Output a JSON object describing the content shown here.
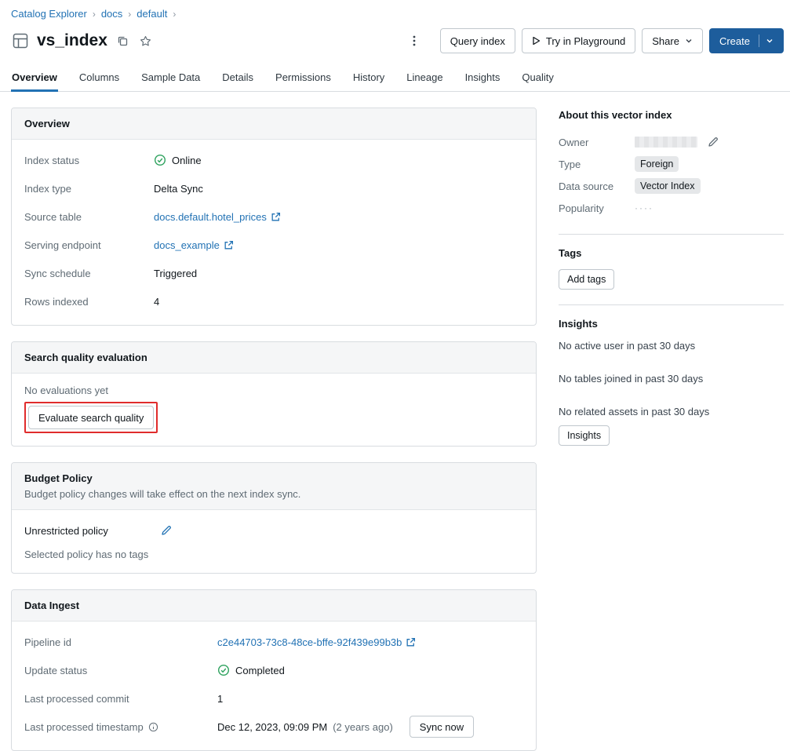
{
  "colors": {
    "accent_link": "#2272B4",
    "primary_button": "#1D5D9C",
    "success_green": "#2EA25E",
    "annotation_red": "#E02C2C",
    "card_header_bg": "#F5F6F7"
  },
  "breadcrumb": {
    "separator": "›",
    "items": [
      "Catalog Explorer",
      "docs",
      "default"
    ]
  },
  "header": {
    "title": "vs_index",
    "query_index_button": "Query index",
    "playground_button": "Try in Playground",
    "share_button": "Share",
    "create_button": "Create"
  },
  "tabs": {
    "active": "Overview",
    "items": [
      "Overview",
      "Columns",
      "Sample Data",
      "Details",
      "Permissions",
      "History",
      "Lineage",
      "Insights",
      "Quality"
    ]
  },
  "overview_card": {
    "title": "Overview",
    "index_status_label": "Index status",
    "index_status_value": "Online",
    "index_type_label": "Index type",
    "index_type_value": "Delta Sync",
    "source_table_label": "Source table",
    "source_table_value": "docs.default.hotel_prices",
    "serving_endpoint_label": "Serving endpoint",
    "serving_endpoint_value": "docs_example",
    "sync_schedule_label": "Sync schedule",
    "sync_schedule_value": "Triggered",
    "rows_indexed_label": "Rows indexed",
    "rows_indexed_value": "4"
  },
  "search_quality_card": {
    "title": "Search quality evaluation",
    "empty_text": "No evaluations yet",
    "evaluate_button": "Evaluate search quality"
  },
  "budget_card": {
    "title": "Budget Policy",
    "subtitle": "Budget policy changes will take effect on the next index sync.",
    "policy_name": "Unrestricted policy",
    "policy_tags_text": "Selected policy has no tags"
  },
  "data_ingest_card": {
    "title": "Data Ingest",
    "pipeline_id_label": "Pipeline id",
    "pipeline_id_value": "c2e44703-73c8-48ce-bffe-92f439e99b3b",
    "update_status_label": "Update status",
    "update_status_value": "Completed",
    "last_commit_label": "Last processed commit",
    "last_commit_value": "1",
    "last_timestamp_label": "Last processed timestamp",
    "last_timestamp_value": "Dec 12, 2023, 09:09 PM",
    "last_timestamp_ago": "(2 years ago)",
    "sync_now_button": "Sync now"
  },
  "sidebar": {
    "about_title": "About this vector index",
    "owner_label": "Owner",
    "type_label": "Type",
    "type_value": "Foreign",
    "data_source_label": "Data source",
    "data_source_value": "Vector Index",
    "popularity_label": "Popularity",
    "popularity_placeholder": "····",
    "tags_title": "Tags",
    "add_tags_button": "Add tags",
    "insights_title": "Insights",
    "insights_lines": [
      "No active user in past 30 days",
      "No tables joined in past 30 days",
      "No related assets in past 30 days"
    ],
    "insights_button": "Insights"
  }
}
